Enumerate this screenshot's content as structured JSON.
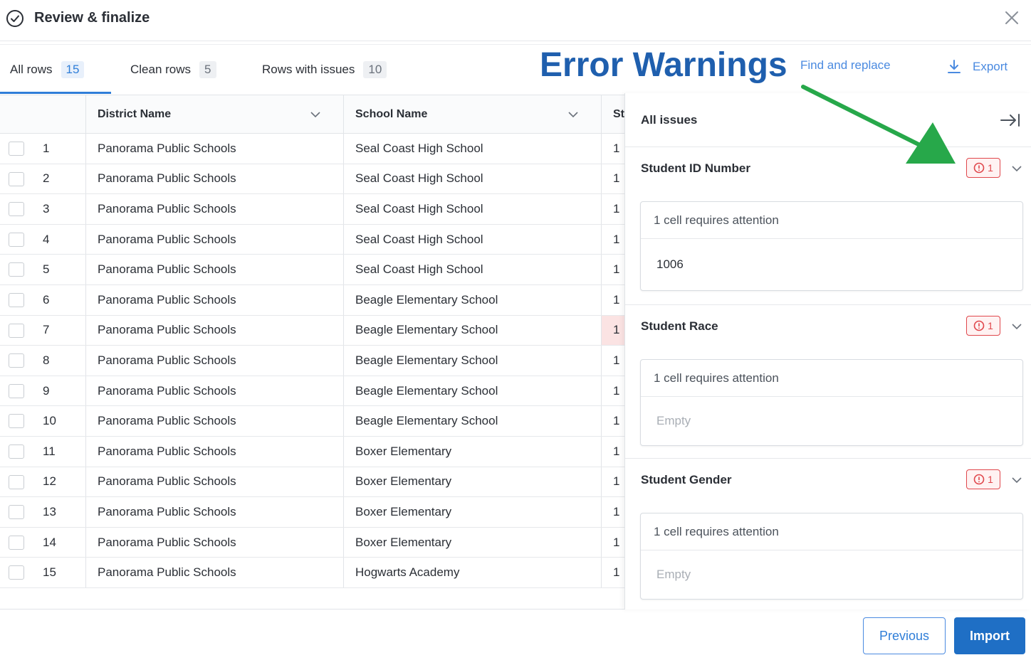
{
  "header": {
    "title": "Review & finalize",
    "icon": "check-circle-icon",
    "close_icon": "close-icon"
  },
  "tabs": [
    {
      "label": "All rows",
      "count": "15",
      "active": true
    },
    {
      "label": "Clean rows",
      "count": "5",
      "active": false
    },
    {
      "label": "Rows with issues",
      "count": "10",
      "active": false
    }
  ],
  "toolbar": {
    "find_replace": "Find and replace",
    "export": "Export"
  },
  "annotation": {
    "text": "Error Warnings",
    "color": "#1f5fae",
    "arrow_color": "#27a84a"
  },
  "table": {
    "columns": [
      "District Name",
      "School Name",
      "St"
    ],
    "rows": [
      {
        "num": "1",
        "district": "Panorama Public Schools",
        "school": "Seal Coast High School",
        "st": "1"
      },
      {
        "num": "2",
        "district": "Panorama Public Schools",
        "school": "Seal Coast High School",
        "st": "1"
      },
      {
        "num": "3",
        "district": "Panorama Public Schools",
        "school": "Seal Coast High School",
        "st": "1"
      },
      {
        "num": "4",
        "district": "Panorama Public Schools",
        "school": "Seal Coast High School",
        "st": "1"
      },
      {
        "num": "5",
        "district": "Panorama Public Schools",
        "school": "Seal Coast High School",
        "st": "1"
      },
      {
        "num": "6",
        "district": "Panorama Public Schools",
        "school": "Beagle Elementary School",
        "st": "1"
      },
      {
        "num": "7",
        "district": "Panorama Public Schools",
        "school": "Beagle Elementary School",
        "st": "1"
      },
      {
        "num": "8",
        "district": "Panorama Public Schools",
        "school": "Beagle Elementary School",
        "st": "1"
      },
      {
        "num": "9",
        "district": "Panorama Public Schools",
        "school": "Beagle Elementary School",
        "st": "1"
      },
      {
        "num": "10",
        "district": "Panorama Public Schools",
        "school": "Beagle Elementary School",
        "st": "1"
      },
      {
        "num": "11",
        "district": "Panorama Public Schools",
        "school": "Boxer Elementary",
        "st": "1"
      },
      {
        "num": "12",
        "district": "Panorama Public Schools",
        "school": "Boxer Elementary",
        "st": "1"
      },
      {
        "num": "13",
        "district": "Panorama Public Schools",
        "school": "Boxer Elementary",
        "st": "1"
      },
      {
        "num": "14",
        "district": "Panorama Public Schools",
        "school": "Boxer Elementary",
        "st": "1"
      },
      {
        "num": "15",
        "district": "Panorama Public Schools",
        "school": "Hogwarts Academy",
        "st": "1"
      }
    ],
    "error_row": "7"
  },
  "issues_panel": {
    "title": "All issues",
    "sections": [
      {
        "title": "Student ID Number",
        "error_count": "1",
        "message": "1 cell requires attention",
        "value": "1006",
        "is_empty": false
      },
      {
        "title": "Student Race",
        "error_count": "1",
        "message": "1 cell requires attention",
        "value": "Empty",
        "is_empty": true
      },
      {
        "title": "Student Gender",
        "error_count": "1",
        "message": "1 cell requires attention",
        "value": "Empty",
        "is_empty": true
      }
    ]
  },
  "footer": {
    "previous": "Previous",
    "import": "Import"
  },
  "colors": {
    "accent": "#2f7ed8",
    "primary_button": "#1f6fc5",
    "error": "#e0474c",
    "error_cell_bg": "#fbe3e3"
  }
}
